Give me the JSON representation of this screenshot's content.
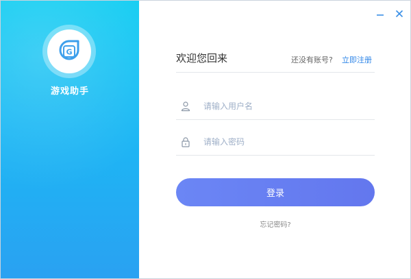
{
  "app": {
    "name": "游戏助手",
    "logo_letter": "G"
  },
  "window_controls": {
    "minimize": "minimize",
    "close": "close"
  },
  "form": {
    "welcome": "欢迎您回来",
    "register_hint": "还没有账号?",
    "register_link": "立即注册",
    "username_placeholder": "请输入用户名",
    "password_placeholder": "请输入密码",
    "login_label": "登录",
    "forgot_label": "忘记密码?"
  },
  "colors": {
    "accent": "#6b86f5",
    "link": "#2f86e8",
    "banner_top": "#12cdf2",
    "banner_bottom": "#2aa1f2"
  }
}
